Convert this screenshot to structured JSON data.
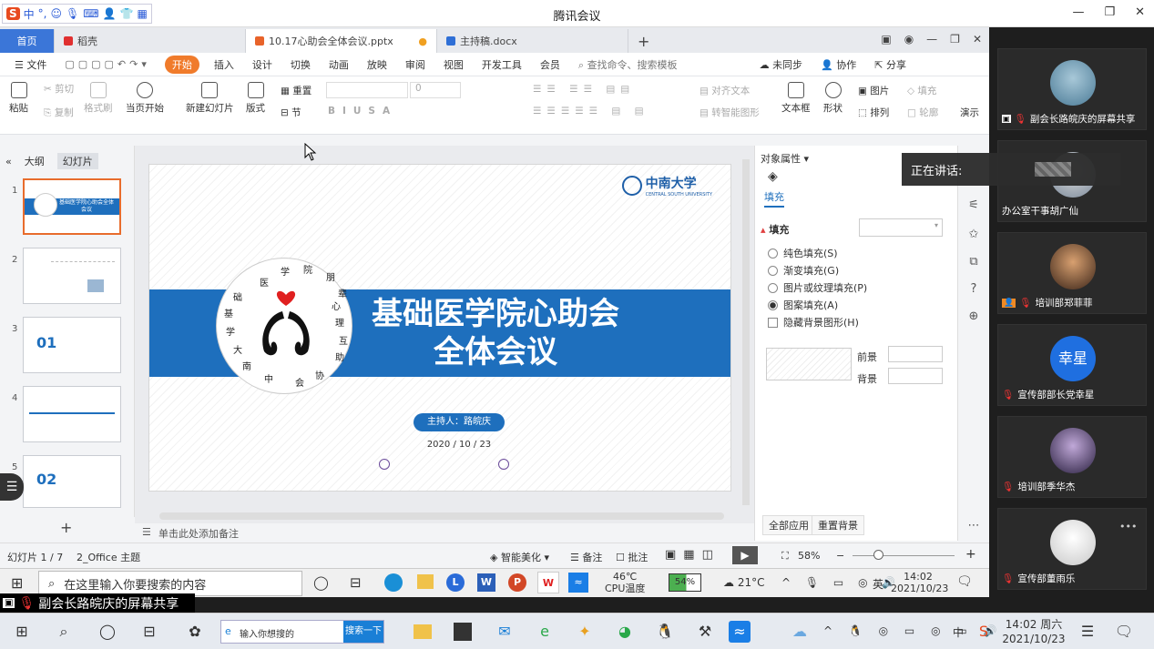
{
  "tencent": {
    "title": "腾讯会议",
    "win_controls": [
      "—",
      "❐",
      "✕"
    ]
  },
  "ime": [
    "S",
    "中",
    "°,",
    "☺",
    "🎙",
    "⌨",
    "👤",
    "👕",
    "▦"
  ],
  "wps": {
    "tabs": [
      {
        "label": "首页"
      },
      {
        "label": "稻壳"
      },
      {
        "label": "10.17心助会全体会议.pptx"
      },
      {
        "label": "主持稿.docx"
      }
    ],
    "tab_add": "+",
    "menu": [
      "文件",
      "开始",
      "插入",
      "设计",
      "切换",
      "动画",
      "放映",
      "审阅",
      "视图",
      "开发工具",
      "会员"
    ],
    "search_placeholder": "查找命令、搜索模板",
    "sync": "未同步",
    "collab": "协作",
    "share": "分享",
    "ribbon": {
      "paste": "粘贴",
      "cut": "剪切",
      "copy": "复制",
      "format_painter": "格式刷",
      "from_current": "当页开始",
      "new_slide": "新建幻灯片",
      "layout": "版式",
      "reset": "重置",
      "section": "节",
      "font_size": "0",
      "align_text": "对齐文本",
      "smart_graphic": "转智能图形",
      "textbox": "文本框",
      "shape": "形状",
      "picture": "图片",
      "fill": "填充",
      "arrange": "排列",
      "outline": "轮廓",
      "present": "演示"
    },
    "left_tabs": [
      "大纲",
      "幻灯片"
    ],
    "thumbs": [
      {
        "num": "1",
        "title": "基础医学院心助会全体会议"
      },
      {
        "num": "2",
        "title": ""
      },
      {
        "num": "3",
        "title": "01"
      },
      {
        "num": "4",
        "title": ""
      },
      {
        "num": "5",
        "title": "02"
      }
    ],
    "add_slide": "+",
    "slide": {
      "logo_text": "中南大学",
      "logo_sub": "CENTRAL SOUTH UNIVERSITY",
      "title_line1": "基础医学院心助会",
      "title_line2": "全体会议",
      "host": "主持人：路皖庆",
      "date": "2020 / 10 / 23",
      "emblem_chars": [
        "医",
        "学",
        "院",
        "朋",
        "辈",
        "心",
        "理",
        "互",
        "助",
        "协",
        "会",
        "中",
        "南",
        "大",
        "学",
        "基",
        "础"
      ]
    },
    "panel": {
      "header": "对象属性",
      "tab": "填充",
      "section": "填充",
      "options": [
        {
          "label": "纯色填充(S)",
          "checked": false
        },
        {
          "label": "渐变填充(G)",
          "checked": false
        },
        {
          "label": "图片或纹理填充(P)",
          "checked": false
        },
        {
          "label": "图案填充(A)",
          "checked": true
        }
      ],
      "hide_bg": "隐藏背景图形(H)",
      "fg": "前景",
      "bg": "背景",
      "apply_all": "全部应用",
      "reset_bg": "重置背景"
    },
    "notes": "单击此处添加备注",
    "status": {
      "slide": "幻灯片 1 / 7",
      "theme": "2_Office 主题",
      "beautify": "智能美化",
      "notes": "备注",
      "comment": "批注",
      "zoom": "58%"
    }
  },
  "inner_taskbar": {
    "search": "在这里输入你要搜索的内容",
    "cpu_temp": "46℃",
    "cpu_label": "CPU温度",
    "battery": "54%",
    "weather": "21°C",
    "lang": "英",
    "time": "14:02",
    "date": "2021/10/23"
  },
  "share_label": "副会长路皖庆的屏幕共享",
  "speaking": "正在讲话:",
  "participants": [
    {
      "name": "副会长路皖庆的屏幕共享",
      "avatar": "photo"
    },
    {
      "name": "办公室干事胡广仙",
      "avatar": "photo"
    },
    {
      "name": "培训部郑菲菲",
      "avatar": "photo"
    },
    {
      "name": "宣传部部长党幸星",
      "avatar": "text",
      "avatar_text": "幸星"
    },
    {
      "name": "培训部季华杰",
      "avatar": "photo"
    },
    {
      "name": "宣传部董雨乐",
      "avatar": "photo"
    }
  ],
  "more": "•••",
  "outer_taskbar": {
    "search": "输入你想搜的",
    "search_btn": "搜索一下",
    "lang": "中",
    "time": "14:02 周六",
    "date": "2021/10/23"
  },
  "colors": {
    "accent": "#1e6fbd",
    "start": "#f07b2b",
    "wps_home": "#3b76d8"
  }
}
